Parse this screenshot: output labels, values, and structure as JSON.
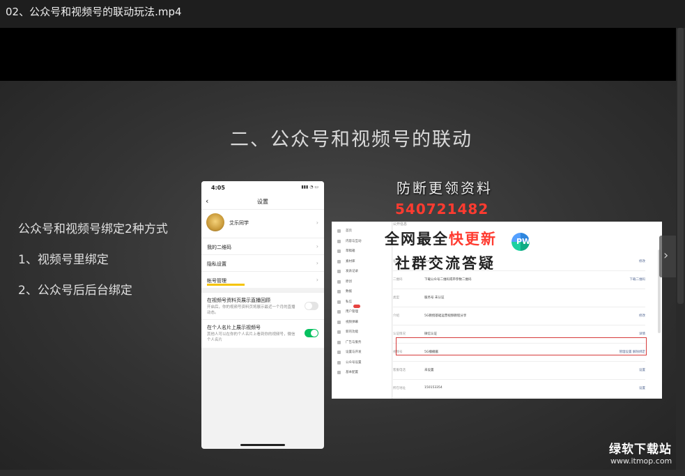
{
  "window": {
    "title": "02、公众号和视频号的联动玩法.mp4"
  },
  "slide": {
    "heading": "二、公众号和视频号的联动",
    "lines": [
      "公众号和视频号绑定2种方式",
      "1、视频号里绑定",
      "2、公众号后后台绑定"
    ]
  },
  "phone": {
    "time": "4:05",
    "nav_title": "设置",
    "profile_name": "艾乐同学",
    "menu": [
      "我的二维码",
      "隐私设置",
      "帐号管理"
    ],
    "settings": [
      {
        "title": "在视频号资料页展示直播回顾",
        "desc": "开启后，你的视频号资料页将展示最近一个月的直播动态。",
        "on": false
      },
      {
        "title": "在个人名片上展示视频号",
        "desc": "其他人可以在你的个人名片上看到你的视频号，微信个人名片",
        "on": true
      }
    ]
  },
  "panel": {
    "section": "公开信息",
    "sidebar": [
      "首页",
      "内容与互动",
      "草稿箱",
      "素材库",
      "发表记录",
      "原创",
      "数据",
      "私信",
      "用户管理",
      "视频弹幕",
      "新的功能",
      "广告与服务",
      "设置与开发",
      "公众号设置",
      "基本配置"
    ],
    "rows": [
      {
        "k": "名称",
        "v": "Ai小0001",
        "a": "修改"
      },
      {
        "k": "二维码",
        "v": "下载公众号二维码或带参数二维码",
        "a": "下载二维码"
      },
      {
        "k": "类型",
        "v": "服务号 未认证",
        "a": ""
      },
      {
        "k": "介绍",
        "v": "5G教授基础运营视频教程分享",
        "a": "修改"
      },
      {
        "k": "认证情况",
        "v": "微信认证",
        "a": "详情"
      },
      {
        "k": "视频号",
        "v": "5G播播酱",
        "a": "管理设置 解除绑定"
      },
      {
        "k": "客服电话",
        "v": "未设置",
        "a": "设置"
      },
      {
        "k": "所在地址",
        "v": "150153354",
        "a": "设置"
      },
      {
        "k": "主体信息",
        "v": "未设置",
        "a": "设置"
      }
    ]
  },
  "overlay": {
    "line1": "防断更领资料",
    "number": "540721482",
    "line3a": "全网最全",
    "line3b": "快更新",
    "line4": "社群交流答疑",
    "logo_letters": "PW"
  },
  "watermark": {
    "name": "绿软下载站",
    "url": "www.itmop.com"
  },
  "colors": {
    "red_box": "#d63a3a",
    "toggle_on": "#07c160",
    "overlay_red": "#ff3b30"
  }
}
